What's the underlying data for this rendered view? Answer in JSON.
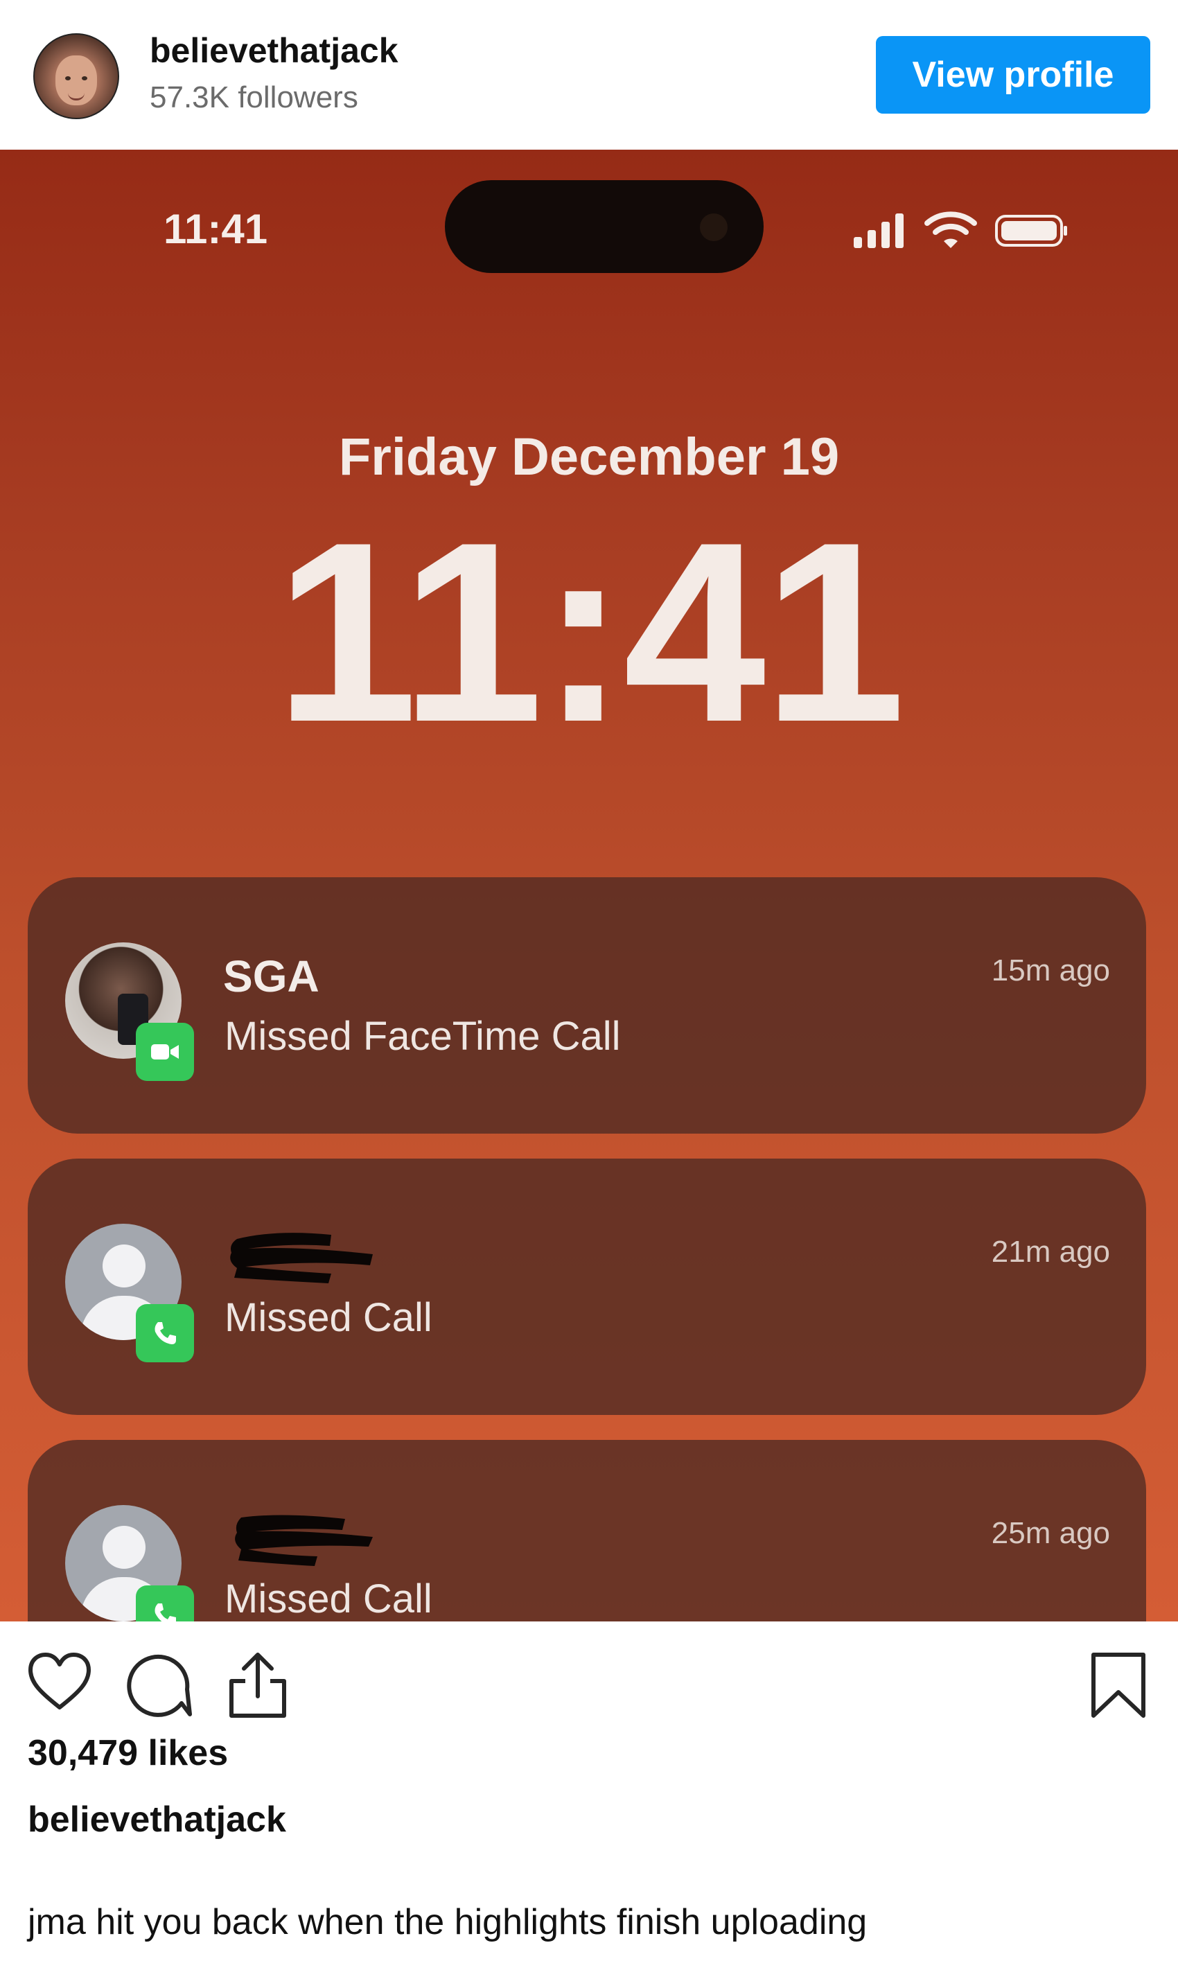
{
  "header": {
    "username": "believethatjack",
    "followers": "57.3K followers",
    "view_profile_label": "View profile"
  },
  "lockscreen": {
    "status_time": "11:41",
    "date": "Friday December 19",
    "clock": "11:41",
    "notifications": [
      {
        "title": "SGA",
        "body": "Missed FaceTime Call",
        "time": "15m ago",
        "app_icon": "facetime-icon"
      },
      {
        "title": "",
        "body": "Missed Call",
        "time": "21m ago",
        "app_icon": "phone-icon"
      },
      {
        "title": "",
        "body": "Missed Call",
        "time": "25m ago",
        "app_icon": "phone-icon"
      }
    ]
  },
  "post": {
    "likes": "30,479 likes",
    "caption_username": "believethatjack",
    "caption": "jma hit you back when the highlights finish uploading"
  },
  "colors": {
    "button_blue": "#0a95f6",
    "lockscreen_top": "#962b16",
    "lockscreen_bottom": "#d45d35",
    "notification_bg": "#4e2a22",
    "badge_green": "#35c759"
  }
}
